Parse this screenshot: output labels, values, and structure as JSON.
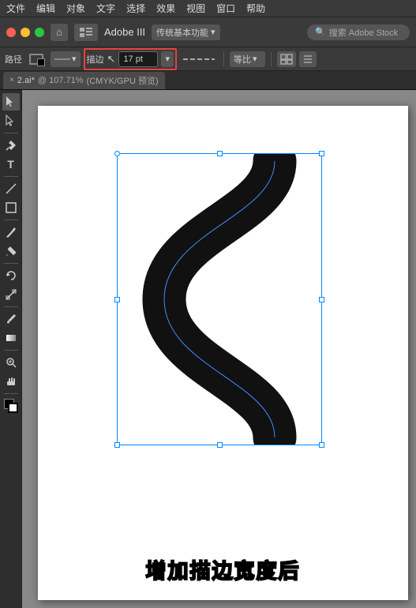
{
  "menu": {
    "items": [
      "文件",
      "编辑",
      "对象",
      "文字",
      "选择",
      "效果",
      "视图",
      "窗口",
      "帮助"
    ]
  },
  "titlebar": {
    "app_name": "Adobe III",
    "workspace": "传统基本功能",
    "search_placeholder": "搜索 Adobe Stock"
  },
  "optionsbar": {
    "path_label": "路径",
    "stroke_label": "描边",
    "stroke_width": "17 pt",
    "ratio_label": "等比"
  },
  "tab": {
    "close_label": "×",
    "file_name": "2.ai*",
    "zoom": "107.71%",
    "color_mode": "CMYK/GPU 预览"
  },
  "caption": {
    "text": "增加描边宽度后"
  },
  "tools": [
    {
      "name": "select-tool",
      "icon": "↖"
    },
    {
      "name": "direct-select-tool",
      "icon": "↗"
    },
    {
      "name": "pen-tool",
      "icon": "✒"
    },
    {
      "name": "type-tool",
      "icon": "T"
    },
    {
      "name": "line-tool",
      "icon": "\\"
    },
    {
      "name": "rectangle-tool",
      "icon": "□"
    },
    {
      "name": "paintbrush-tool",
      "icon": "✏"
    },
    {
      "name": "pencil-tool",
      "icon": "✐"
    },
    {
      "name": "blob-brush-tool",
      "icon": "⬬"
    },
    {
      "name": "eraser-tool",
      "icon": "◻"
    },
    {
      "name": "rotate-tool",
      "icon": "↻"
    },
    {
      "name": "scale-tool",
      "icon": "⤡"
    },
    {
      "name": "warp-tool",
      "icon": "≈"
    },
    {
      "name": "free-transform-tool",
      "icon": "⊡"
    },
    {
      "name": "eyedropper-tool",
      "icon": "⊘"
    },
    {
      "name": "blend-tool",
      "icon": "◑"
    },
    {
      "name": "gradient-tool",
      "icon": "▣"
    },
    {
      "name": "mesh-tool",
      "icon": "⊞"
    },
    {
      "name": "zoom-tool",
      "icon": "⊕"
    },
    {
      "name": "hand-tool",
      "icon": "✋"
    },
    {
      "name": "artboard-tool",
      "icon": "⊡"
    },
    {
      "name": "fill-color",
      "icon": "■"
    },
    {
      "name": "stroke-color",
      "icon": "□"
    }
  ]
}
